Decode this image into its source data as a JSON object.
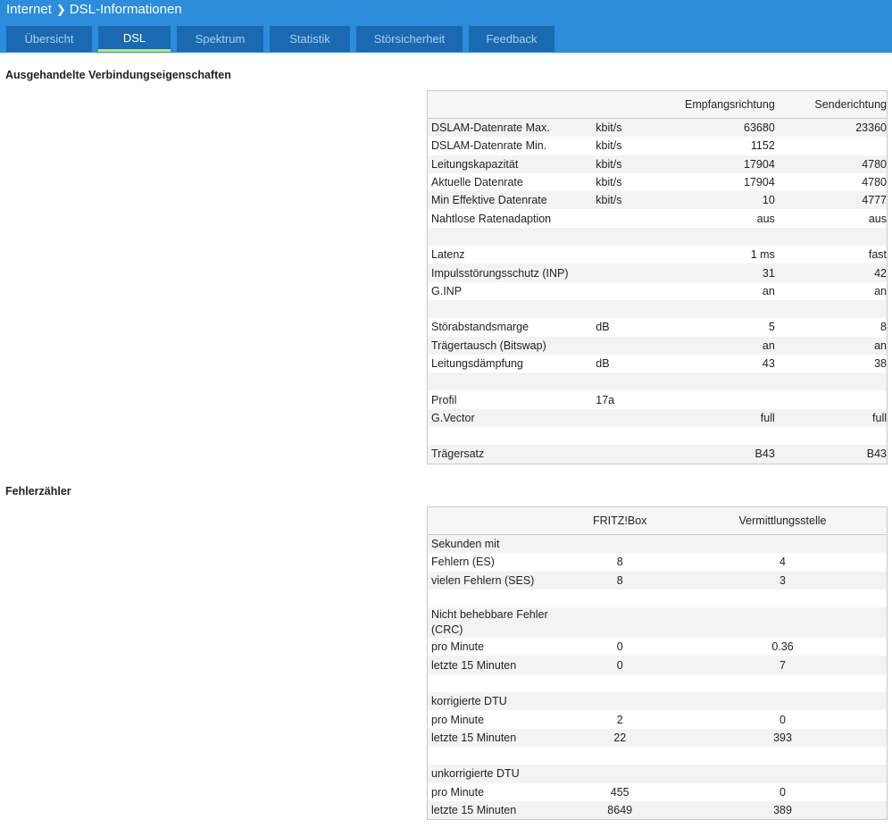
{
  "breadcrumb": {
    "parent": "Internet",
    "current": "DSL-Informationen"
  },
  "tabs": [
    {
      "label": "Übersicht",
      "active": false
    },
    {
      "label": "DSL",
      "active": true
    },
    {
      "label": "Spektrum",
      "active": false
    },
    {
      "label": "Statistik",
      "active": false
    },
    {
      "label": "Störsicherheit",
      "active": false
    },
    {
      "label": "Feedback",
      "active": false
    }
  ],
  "colors": {
    "header": "#2b8ddb",
    "tab": "#1b69b1",
    "tab_active_underline": "#c9e64b"
  },
  "section1": {
    "title": "Ausgehandelte Verbindungseigenschaften",
    "columns": [
      "",
      "",
      "Empfangsrichtung",
      "Senderichtung"
    ],
    "rows": [
      [
        "DSLAM-Datenrate Max.",
        "kbit/s",
        "63680",
        "23360"
      ],
      [
        "DSLAM-Datenrate Min.",
        "kbit/s",
        "1152",
        ""
      ],
      [
        "Leitungskapazität",
        "kbit/s",
        "17904",
        "4780"
      ],
      [
        "Aktuelle Datenrate",
        "kbit/s",
        "17904",
        "4780"
      ],
      [
        "Min Effektive Datenrate",
        "kbit/s",
        "10",
        "4777"
      ],
      [
        "Nahtlose Ratenadaption",
        "",
        "aus",
        "aus"
      ],
      [
        "",
        "",
        "",
        ""
      ],
      [
        "Latenz",
        "",
        "1 ms",
        "fast"
      ],
      [
        "Impulsstörungsschutz (INP)",
        "",
        "31",
        "42"
      ],
      [
        "G.INP",
        "",
        "an",
        "an"
      ],
      [
        "",
        "",
        "",
        ""
      ],
      [
        "Störabstandsmarge",
        "dB",
        "5",
        "8"
      ],
      [
        "Trägertausch (Bitswap)",
        "",
        "an",
        "an"
      ],
      [
        "Leitungsdämpfung",
        "dB",
        "43",
        "38"
      ],
      [
        "",
        "",
        "",
        ""
      ],
      [
        "Profil",
        "17a",
        "",
        ""
      ],
      [
        "G.Vector",
        "",
        "full",
        "full"
      ],
      [
        "",
        "",
        "",
        ""
      ],
      [
        "Trägersatz",
        "",
        "B43",
        "B43"
      ]
    ]
  },
  "section2": {
    "title": "Fehlerzähler",
    "columns": [
      "",
      "FRITZ!Box",
      "Vermittlungsstelle"
    ],
    "rows": [
      [
        "Sekunden mit",
        "",
        ""
      ],
      [
        "Fehlern (ES)",
        "8",
        "4"
      ],
      [
        "vielen Fehlern (SES)",
        "8",
        "3"
      ],
      [
        "",
        "",
        ""
      ],
      [
        "Nicht behebbare Fehler (CRC)",
        "",
        ""
      ],
      [
        "pro Minute",
        "0",
        "0.36"
      ],
      [
        "letzte 15 Minuten",
        "0",
        "7"
      ],
      [
        "",
        "",
        ""
      ],
      [
        "korrigierte DTU",
        "",
        ""
      ],
      [
        "pro Minute",
        "2",
        "0"
      ],
      [
        "letzte 15 Minuten",
        "22",
        "393"
      ],
      [
        "",
        "",
        ""
      ],
      [
        "unkorrigierte DTU",
        "",
        ""
      ],
      [
        "pro Minute",
        "455",
        "0"
      ],
      [
        "letzte 15 Minuten",
        "8649",
        "389"
      ]
    ]
  }
}
